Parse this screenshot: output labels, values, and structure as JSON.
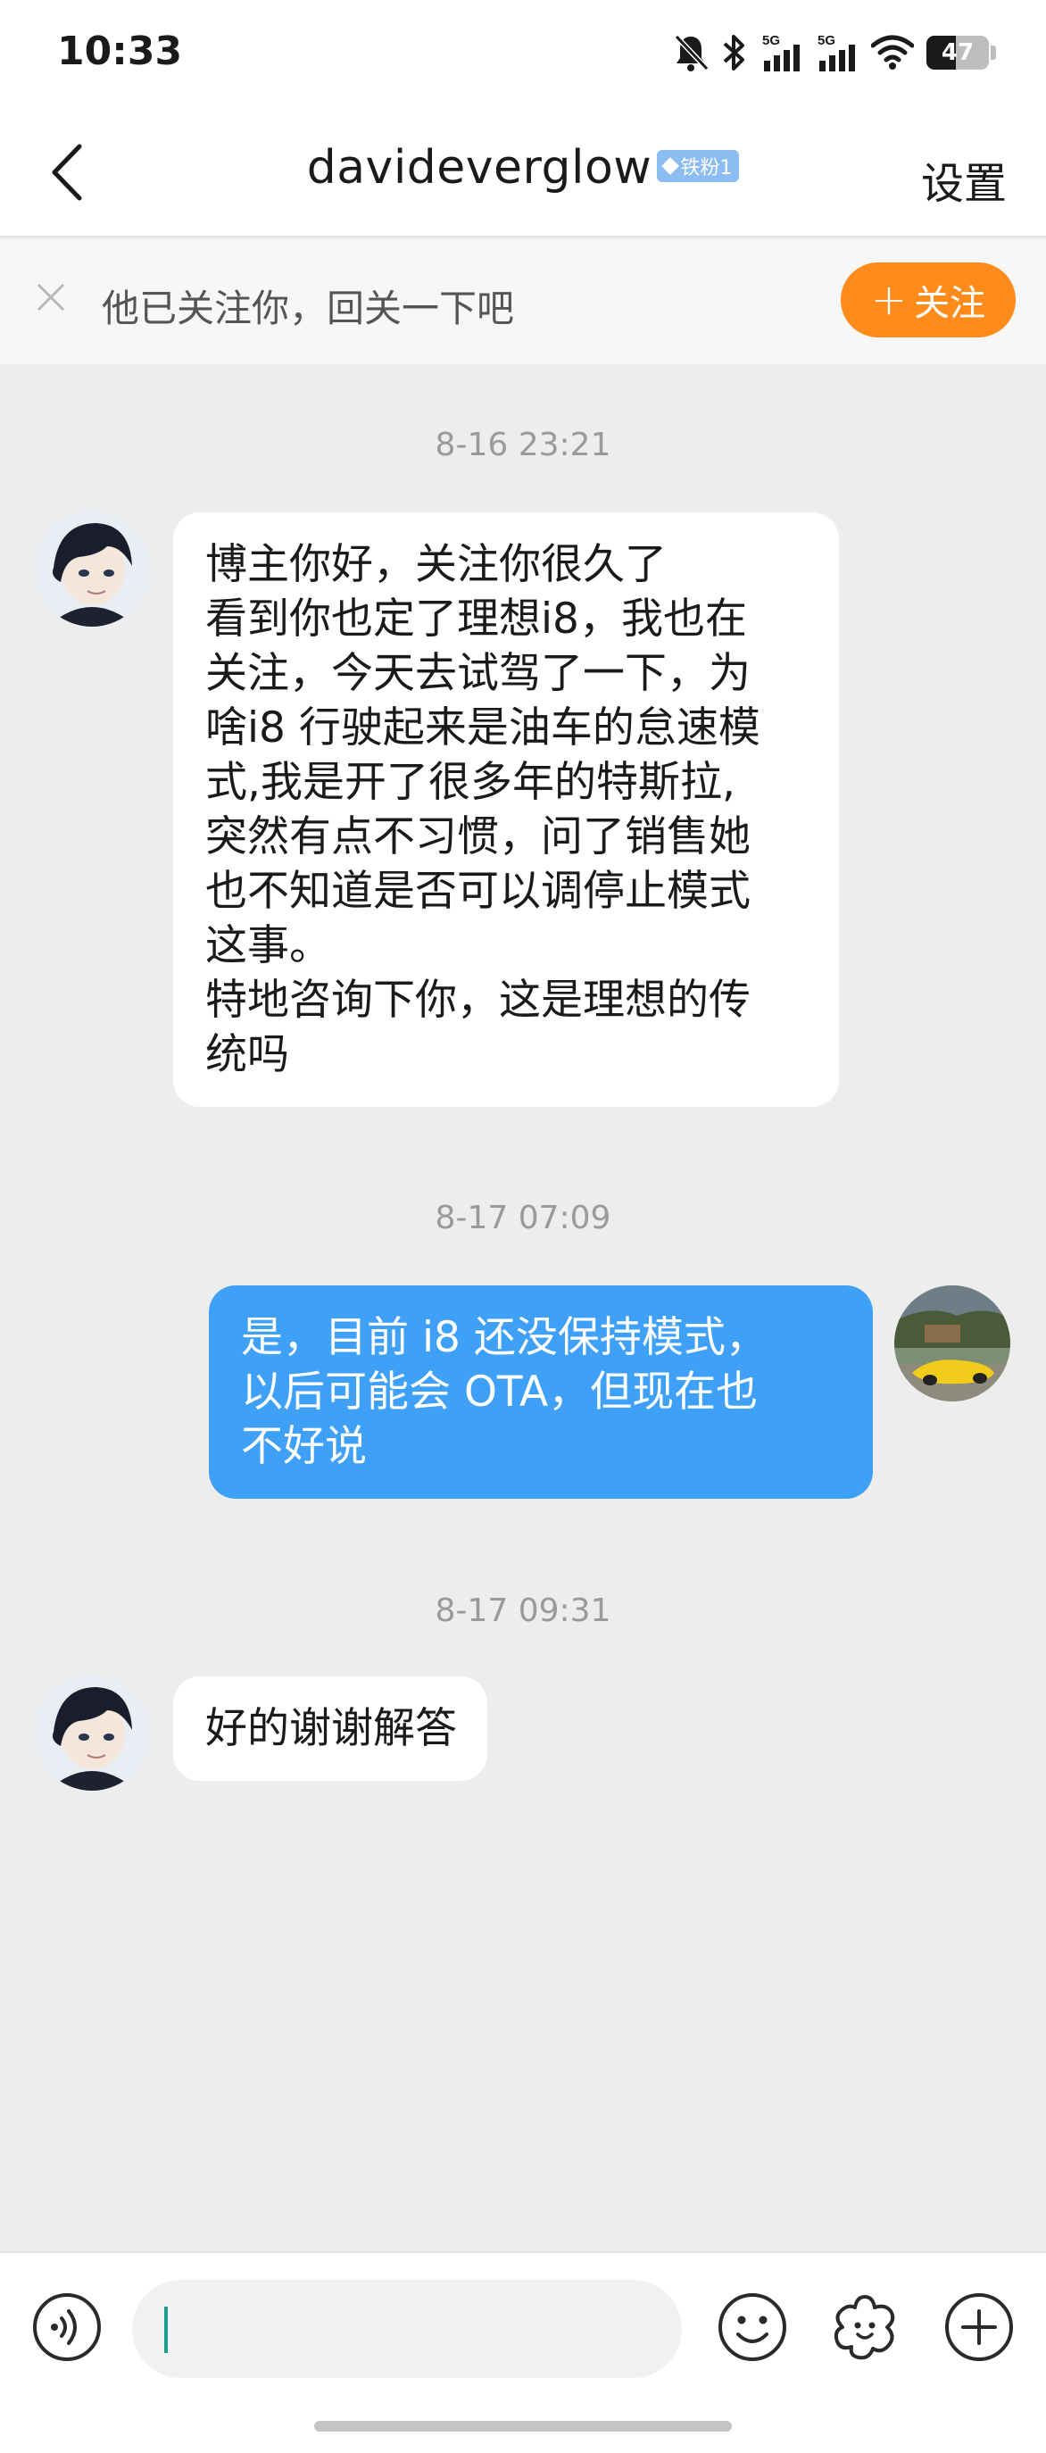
{
  "status_bar": {
    "time": "10:33",
    "battery_level": 47,
    "battery_text": "47",
    "signal_labels": [
      "5G",
      "5G"
    ],
    "icons": [
      "mute-icon",
      "bluetooth-icon",
      "signal-5g-icon",
      "signal-5g-icon",
      "wifi-icon",
      "battery-icon"
    ]
  },
  "header": {
    "title": "davideverglow",
    "badge": "铁粉1",
    "settings_label": "设置",
    "back_icon": "chevron-left-icon"
  },
  "follow_banner": {
    "text": "他已关注你，回关一下吧",
    "button_label": "关注",
    "button_color": "#ff8c1a"
  },
  "messages": [
    {
      "timestamp": "8-16 23:21",
      "direction": "incoming",
      "lines": [
        "博主你好，关注你很久了",
        "看到你也定了理想i8，我也在",
        "关注，今天去试驾了一下，为",
        "啥i8 行驶起来是油车的怠速模",
        "式,我是开了很多年的特斯拉,",
        "突然有点不习惯，问了销售她",
        "也不知道是否可以调停止模式",
        "这事。",
        "特地咨询下你，这是理想的传",
        "统吗"
      ]
    },
    {
      "timestamp": "8-17 07:09",
      "direction": "outgoing",
      "lines": [
        "是，目前 i8 还没保持模式，",
        "以后可能会 OTA，但现在也",
        "不好说"
      ]
    },
    {
      "timestamp": "8-17 09:31",
      "direction": "incoming",
      "lines": [
        "好的谢谢解答"
      ]
    }
  ],
  "input_bar": {
    "input_value": "",
    "icons": [
      "voice-icon",
      "emoji-icon",
      "sticker-icon",
      "plus-icon"
    ]
  },
  "colors": {
    "outgoing_bubble": "#3ea0f7",
    "incoming_bubble": "#ffffff",
    "chat_background": "#ededed",
    "fan_badge": "#8bbcf2"
  }
}
